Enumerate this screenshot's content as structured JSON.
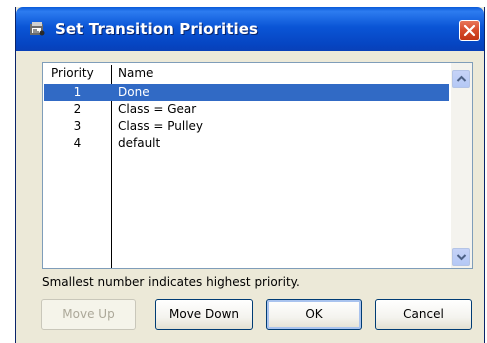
{
  "window": {
    "title": "Set Transition Priorities",
    "title_icon": "app-icon",
    "close_icon": "close-icon"
  },
  "list": {
    "columns": [
      "Priority",
      "Name"
    ],
    "rows": [
      {
        "priority": "1",
        "name": "Done",
        "selected": true
      },
      {
        "priority": "2",
        "name": "Class = Gear",
        "selected": false
      },
      {
        "priority": "3",
        "name": "Class = Pulley",
        "selected": false
      },
      {
        "priority": "4",
        "name": "default",
        "selected": false
      }
    ]
  },
  "hint": "Smallest number indicates highest priority.",
  "buttons": {
    "move_up": "Move Up",
    "move_down": "Move Down",
    "ok": "OK",
    "cancel": "Cancel"
  },
  "colors": {
    "selection": "#316ac5",
    "titlebar": "#0a55d6",
    "close": "#d64a2a"
  }
}
